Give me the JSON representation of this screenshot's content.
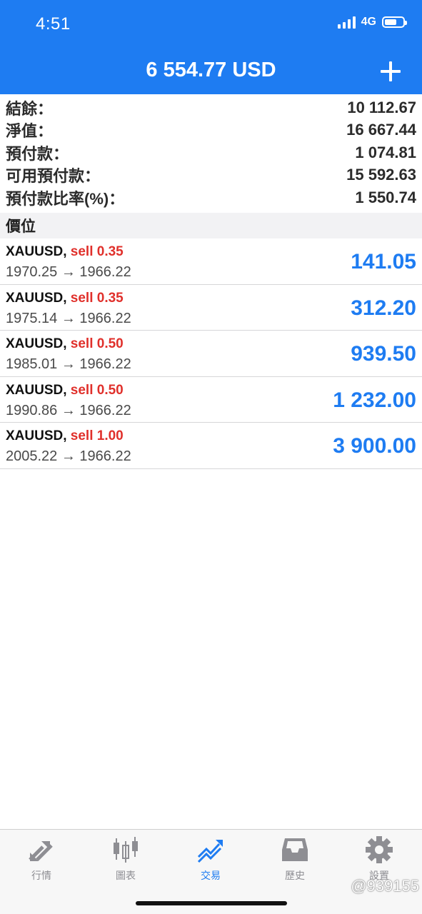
{
  "status": {
    "time": "4:51",
    "network": "4G",
    "battery_level": 0.65
  },
  "header": {
    "title": "6 554.77 USD"
  },
  "summary": [
    {
      "label": "結餘：",
      "value": "10 112.67"
    },
    {
      "label": "淨值：",
      "value": "16 667.44"
    },
    {
      "label": "預付款：",
      "value": "1 074.81"
    },
    {
      "label": "可用預付款：",
      "value": "15 592.63"
    },
    {
      "label": "預付款比率(%)：",
      "value": "1 550.74"
    }
  ],
  "section_title": "價位",
  "positions": [
    {
      "symbol": "XAUUSD,",
      "side": "sell 0.35",
      "prices": "1970.25 → 1966.22",
      "profit": "141.05"
    },
    {
      "symbol": "XAUUSD,",
      "side": "sell 0.35",
      "prices": "1975.14 → 1966.22",
      "profit": "312.20"
    },
    {
      "symbol": "XAUUSD,",
      "side": "sell 0.50",
      "prices": "1985.01 → 1966.22",
      "profit": "939.50"
    },
    {
      "symbol": "XAUUSD,",
      "side": "sell 0.50",
      "prices": "1990.86 → 1966.22",
      "profit": "1 232.00"
    },
    {
      "symbol": "XAUUSD,",
      "side": "sell 1.00",
      "prices": "2005.22 → 1966.22",
      "profit": "3 900.00"
    }
  ],
  "tabs": [
    {
      "label": "行情",
      "icon": "quotes-arrows-icon"
    },
    {
      "label": "圖表",
      "icon": "candlestick-icon"
    },
    {
      "label": "交易",
      "icon": "trade-trend-icon",
      "active": true
    },
    {
      "label": "歷史",
      "icon": "inbox-history-icon"
    },
    {
      "label": "設置",
      "icon": "gear-icon"
    }
  ],
  "watermark": "@939155",
  "colors": {
    "accent": "#1e7cf2",
    "sell": "#e0302b",
    "profit": "#1e7cf2"
  }
}
